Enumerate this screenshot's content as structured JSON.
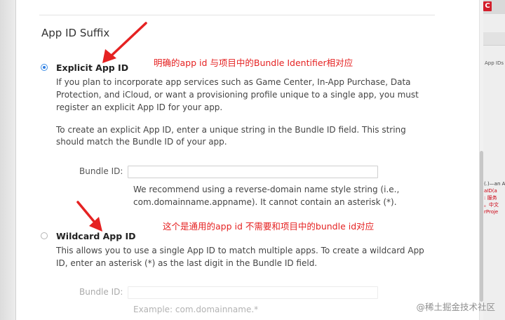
{
  "section": {
    "title": "App ID Suffix"
  },
  "explicit": {
    "title": "Explicit App ID",
    "selected": true,
    "description": [
      "If you plan to incorporate app services such as Game Center, In-App Purchase, Data",
      "Protection, and iCloud, or want a provisioning profile unique to a single app, you must",
      "register an explicit App ID for your app."
    ],
    "instruction": [
      "To create an explicit App ID, enter a unique string in the Bundle ID field. This string",
      "should match the Bundle ID of your app."
    ],
    "bundle_label": "Bundle ID:",
    "bundle_value": "",
    "hint": [
      "We recommend using a reverse-domain name style string (i.e.,",
      "com.domainname.appname). It cannot contain an asterisk (*)."
    ]
  },
  "wildcard": {
    "title": "Wildcard App ID",
    "selected": false,
    "description": [
      "This allows you to use a single App ID to match multiple apps. To create a wildcard App",
      "ID, enter an asterisk (*) as the last digit in the Bundle ID field."
    ],
    "bundle_label": "Bundle ID:",
    "bundle_value": "",
    "hint": "Example: com.domainname.*"
  },
  "annotations": {
    "explicit_note": "明确的app id 与项目中的Bundle Identifier相对应",
    "wildcard_note": "这个是通用的app id 不需要和项目中的bundle id对应"
  },
  "side_window": {
    "logo": "C",
    "lines": [
      "App IDs",
      "(.)—an App",
      "aID(a",
      ": 服务",
      "。中文",
      "rProje"
    ]
  },
  "watermark": "@稀土掘金技术社区",
  "colors": {
    "annotation": "#e52222",
    "radio_selected": "#2e7de3",
    "side_logo": "#d31e2b"
  }
}
